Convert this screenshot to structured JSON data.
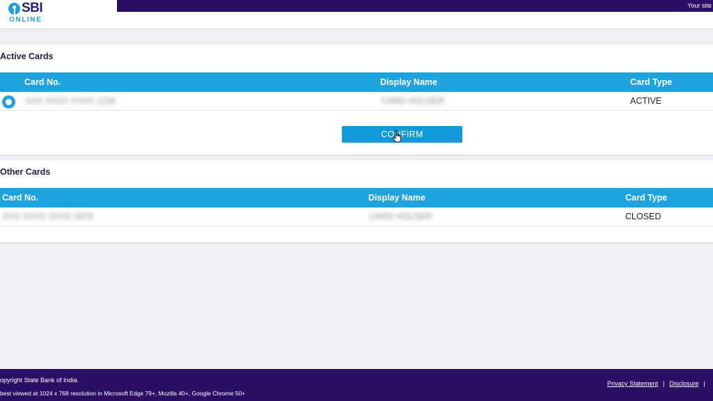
{
  "header": {
    "logo_sbi": "SBI",
    "logo_online": "ONLINE",
    "topbar_text": "Your site"
  },
  "active_cards": {
    "title": "Active Cards",
    "columns": [
      "Card No.",
      "Display Name",
      "Card Type"
    ],
    "rows": [
      {
        "card_no": "XXX XXXX XXXX 1234",
        "display_name": "CARD HOLDER",
        "card_type": "ACTIVE",
        "selected": true
      }
    ],
    "confirm_label": "CONFIRM"
  },
  "other_cards": {
    "title": "Other Cards",
    "columns": [
      "Card No.",
      "Display Name",
      "Card Type"
    ],
    "rows": [
      {
        "card_no": "XXX XXXX XXXX 5678",
        "display_name": "CARD HOLDER",
        "card_type": "CLOSED"
      }
    ]
  },
  "footer": {
    "copyright": "opyright State Bank of India.",
    "best_viewed": "best viewed at 1024 x 768 resolution in Microsoft Edge 79+, Mozilla 40+, Google Chrome 50+",
    "links": [
      "Privacy Statement",
      "Disclosure"
    ]
  },
  "colors": {
    "brand_dark": "#2b0f66",
    "accent_blue": "#1fa3df",
    "button_blue": "#0f9ad9"
  },
  "icons": [
    "sbi-logo-icon",
    "radio-selected-icon",
    "hand-cursor-icon"
  ]
}
